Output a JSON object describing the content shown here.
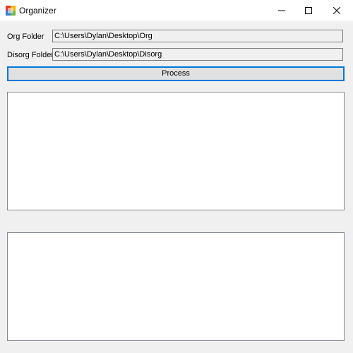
{
  "window": {
    "title": "Organizer"
  },
  "form": {
    "org_label": "Org Folder",
    "org_value": "C:\\Users\\Dylan\\Desktop\\Org",
    "disorg_label": "Disorg Folder",
    "disorg_value": "C:\\Users\\Dylan\\Desktop\\Disorg",
    "process_label": "Process"
  },
  "icons": {
    "app": "app-icon",
    "minimize": "minimize-icon",
    "maximize": "maximize-icon",
    "close": "close-icon"
  },
  "colors": {
    "accent": "#0078d7",
    "window_bg": "#f0f0f0",
    "panel_bg": "#ffffff"
  }
}
